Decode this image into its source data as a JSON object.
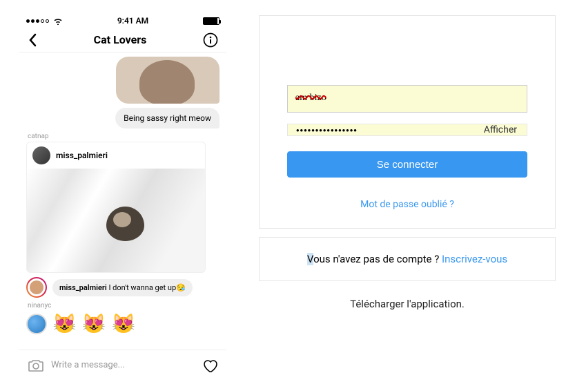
{
  "phone": {
    "status": {
      "time": "9:41 AM"
    },
    "nav": {
      "title": "Cat Lovers"
    },
    "chat": {
      "msg1_text": "Being sassy right meow",
      "sender1": "catnap",
      "card_user": "miss_palmieri",
      "caption_user": "miss_palmieri",
      "caption_text": " I don't wanna get up",
      "caption_emoji": "😪",
      "sender2": "ninanyc",
      "emoji_reactions": [
        "😻",
        "😻",
        "😻"
      ]
    },
    "input": {
      "placeholder": "Write a message..."
    }
  },
  "login": {
    "username_value": "am   bizo",
    "password_dots": "••••••••••••••••",
    "show_label": "Afficher",
    "submit_label": "Se connecter",
    "forgot_label": "Mot de passe oublié ?",
    "signup_prefix_hl": "V",
    "signup_prefix_rest": "ous n'avez pas de compte  ? ",
    "signup_link": "Inscrivez-vous",
    "download_label": "Télécharger l'application."
  }
}
